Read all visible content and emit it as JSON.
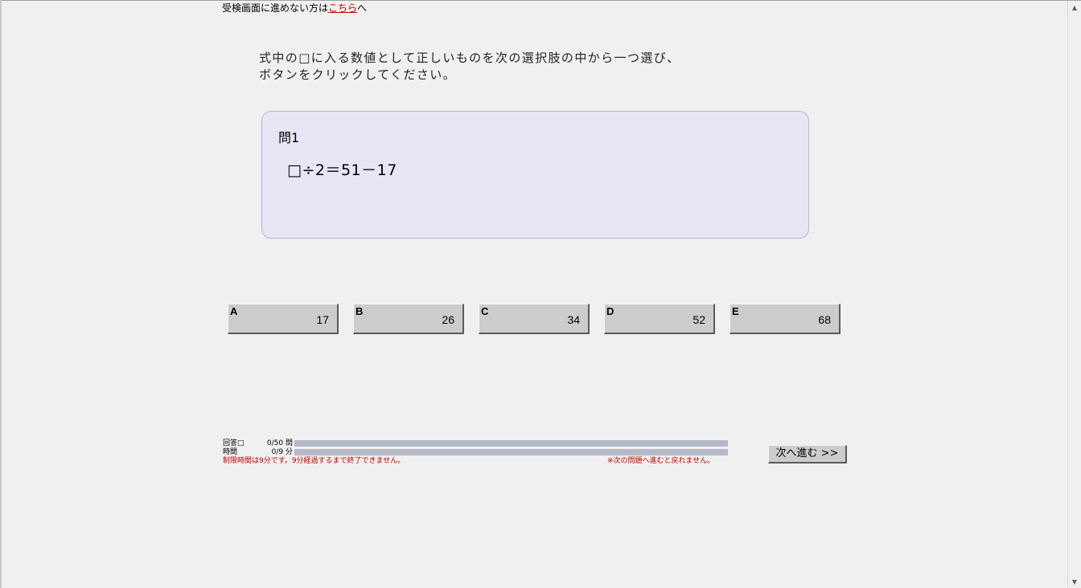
{
  "header": {
    "link_prefix": "受検画面に進めない方は",
    "link_text": "こちら",
    "link_suffix": "へ"
  },
  "instruction": {
    "line1": "式中の□に入る数値として正しいものを次の選択肢の中から一つ選び、",
    "line2": "ボタンをクリックしてください。"
  },
  "question": {
    "number": "問1",
    "expression": "□÷2＝51－17"
  },
  "choices": [
    {
      "letter": "A",
      "value": "17"
    },
    {
      "letter": "B",
      "value": "26"
    },
    {
      "letter": "C",
      "value": "34"
    },
    {
      "letter": "D",
      "value": "52"
    },
    {
      "letter": "E",
      "value": "68"
    }
  ],
  "status": {
    "answered_label": "回答□",
    "answered_count": "0/50 問",
    "answered_fraction": 0,
    "time_label": "時間",
    "time_count": "0/9 分",
    "time_fraction": 0,
    "warning_left": "制限時間は9分です。9分経過するまで終了できません。",
    "warning_right": "※次の問題へ進むと戻れません。"
  },
  "next_button": {
    "label": "次へ進む >>"
  },
  "colors": {
    "link": "#c00000",
    "warning": "#c00000",
    "question_bg": "#e6e6f5",
    "button_bg": "#cccccc",
    "progress_track": "#b4b8c8"
  }
}
